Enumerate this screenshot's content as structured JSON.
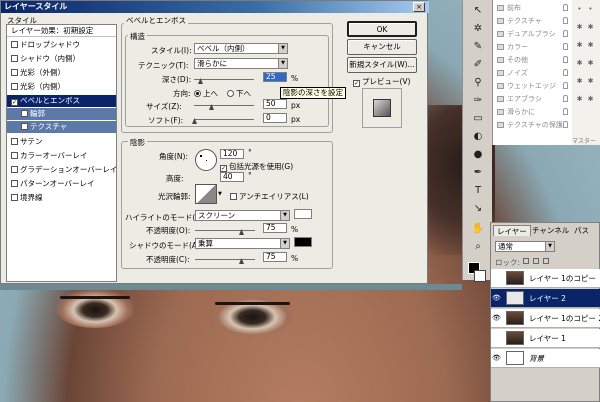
{
  "dialog": {
    "title": "レイヤースタイル",
    "close_label": "×",
    "style_list": {
      "header": "スタイル",
      "items": [
        {
          "label": "レイヤー効果：初期設定",
          "type": "header"
        },
        {
          "label": "ドロップシャドウ",
          "checked": false
        },
        {
          "label": "シャドウ（内側）",
          "checked": false
        },
        {
          "label": "光彩（外側）",
          "checked": false
        },
        {
          "label": "光彩（内側）",
          "checked": false
        },
        {
          "label": "ベベルとエンボス",
          "checked": true,
          "selected": true
        },
        {
          "label": "輪郭",
          "checked": false,
          "sub": true
        },
        {
          "label": "テクスチャ",
          "checked": false,
          "sub": true
        },
        {
          "label": "サテン",
          "checked": false
        },
        {
          "label": "カラーオーバーレイ",
          "checked": false
        },
        {
          "label": "グラデーションオーバーレイ",
          "checked": false
        },
        {
          "label": "パターンオーバーレイ",
          "checked": false
        },
        {
          "label": "境界線",
          "checked": false
        }
      ]
    },
    "bevel": {
      "section_title": "ベベルとエンボス",
      "structure_title": "構造",
      "style_label": "スタイル(I):",
      "style_value": "ベベル（内側）",
      "technique_label": "テクニック(T):",
      "technique_value": "滑らかに",
      "depth_label": "深さ(D):",
      "depth_value": "25",
      "depth_unit": "%",
      "direction_label": "方向:",
      "dir_up": "上へ",
      "dir_down": "下へ",
      "size_label": "サイズ(Z):",
      "size_value": "50",
      "size_unit": "px",
      "soften_label": "ソフト(F):",
      "soften_value": "0",
      "soften_unit": "px",
      "tooltip": "陰影の深さを設定"
    },
    "shading": {
      "title": "陰影",
      "angle_label": "角度(N):",
      "angle_value": "120",
      "angle_unit": "°",
      "global_light_label": "包括光源を使用(G)",
      "altitude_label": "高度:",
      "altitude_value": "40",
      "altitude_unit": "°",
      "gloss_label": "光沢輪郭:",
      "antialias_label": "アンチエイリアス(L)",
      "highlight_label": "ハイライトのモード(H):",
      "highlight_value": "スクリーン",
      "highlight_opacity_label": "不透明度(O):",
      "highlight_opacity": "75",
      "shadow_label": "シャドウのモード(A):",
      "shadow_value": "乗算",
      "shadow_opacity_label": "不透明度(C):",
      "shadow_opacity": "75",
      "percent": "%",
      "highlight_color": "#ffffff",
      "shadow_color": "#000000"
    },
    "buttons": {
      "ok": "OK",
      "cancel": "キャンセル",
      "new_style": "新規スタイル(W)...",
      "preview": "プレビュー(V)"
    }
  },
  "styles_panel": {
    "items": [
      "前布",
      "テクスチャ",
      "デュアルブラシ",
      "カラー",
      "その他",
      "ノイズ",
      "ウェットエッジ",
      "エアブラシ",
      "滑らかに",
      "テクスチャの保護"
    ]
  },
  "swatch_panel": {
    "label": "マスター"
  },
  "layers": {
    "tabs": [
      "レイヤー",
      "チャンネル",
      "パス"
    ],
    "blend_mode": "通常",
    "lock_label": "ロック:",
    "rows": [
      {
        "name": "レイヤー 1のコピー",
        "visible": false,
        "selected": false
      },
      {
        "name": "レイヤー 2",
        "visible": true,
        "selected": true
      },
      {
        "name": "レイヤー 1のコピー 2",
        "visible": true,
        "selected": false
      },
      {
        "name": "レイヤー 1",
        "visible": false,
        "selected": false
      },
      {
        "name": "背景",
        "visible": true,
        "selected": false
      }
    ]
  }
}
